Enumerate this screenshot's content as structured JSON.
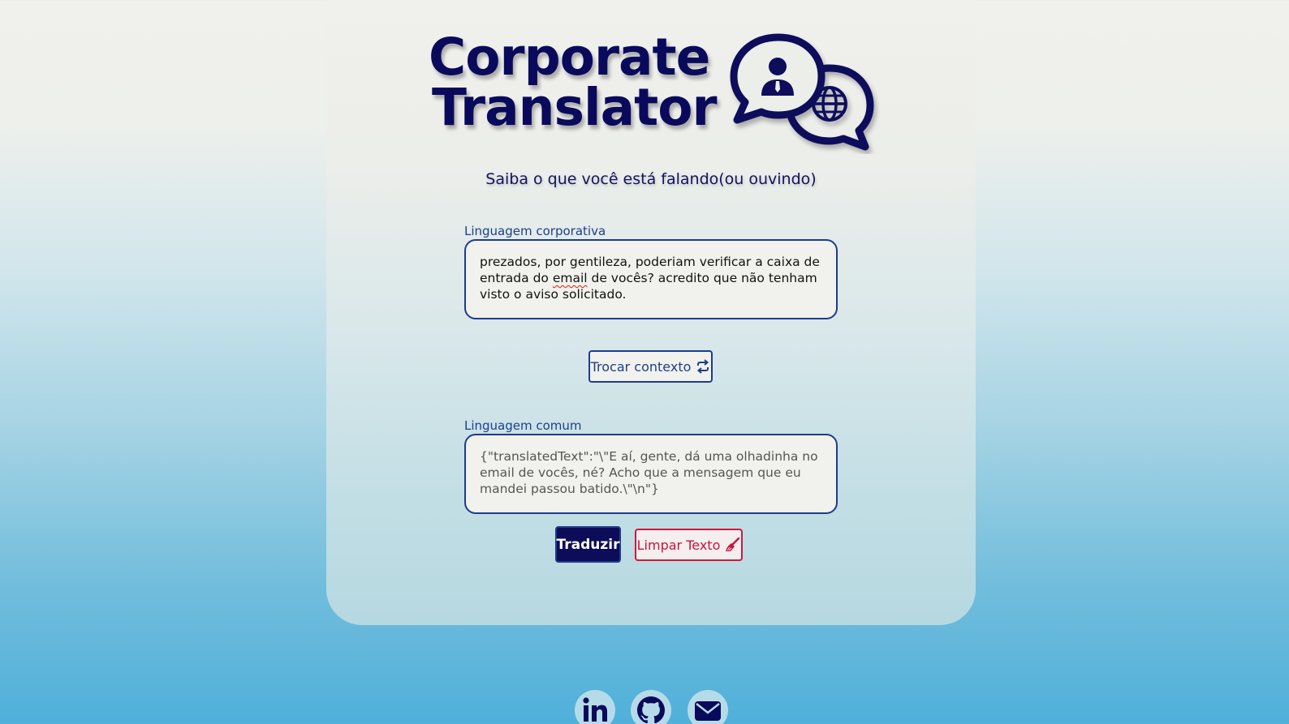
{
  "app": {
    "title_line1": "Corporate",
    "title_line2": "Translator",
    "subtitle": "Saiba o que você está falando(ou ouvindo)"
  },
  "input": {
    "label": "Linguagem corporativa",
    "text_before": "prezados, por gentileza, poderiam verificar a caixa de entrada do ",
    "text_flagged": "email",
    "text_after": " de vocês? acredito que não tenham visto o aviso solicitado."
  },
  "swap_button": {
    "label": "Trocar contexto",
    "icon": "swap-arrows-icon"
  },
  "output": {
    "label": "Linguagem comum",
    "text": "{\"translatedText\":\"\\\"E aí, gente, dá uma olhadinha no email de vocês, né? Acho que a mensagem que eu mandei passou batido.\\\"\\n\"}"
  },
  "actions": {
    "translate_label": "Traduzir",
    "clear_label": "Limpar Texto",
    "clear_icon": "broom-icon"
  },
  "social": [
    {
      "name": "linkedin",
      "icon": "linkedin-icon"
    },
    {
      "name": "github",
      "icon": "github-icon"
    },
    {
      "name": "email",
      "icon": "envelope-icon"
    }
  ],
  "colors": {
    "navy": "#0c0c58",
    "border_blue": "#1e3c8a",
    "label_blue": "#1c3f8c",
    "clear_red": "#c8143a",
    "input_bg": "#f1f1ed"
  }
}
